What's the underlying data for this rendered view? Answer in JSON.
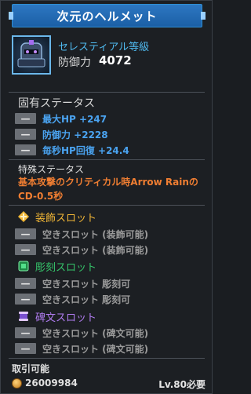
{
  "header": {
    "title": "次元のヘルメット"
  },
  "item": {
    "name": "セレスティアル等級",
    "defense_label": "防御力",
    "defense_value": "4072"
  },
  "inherent": {
    "title": "固有ステータス",
    "stats": [
      {
        "text": "最大HP +247"
      },
      {
        "text": "防御力 +2228"
      },
      {
        "text": "毎秒HP回復 +24.4"
      }
    ]
  },
  "special": {
    "title": "特殊ステータス",
    "text": "基本攻撃のクリティカル時Arrow Rainの CD-0.5秒"
  },
  "accessory": {
    "title": "装飾スロット",
    "slots": [
      "空きスロット (装飾可能)",
      "空きスロット (装飾可能)"
    ]
  },
  "engrave": {
    "title": "彫刻スロット",
    "slots": [
      "空きスロット 彫刻可",
      "空きスロット 彫刻可"
    ]
  },
  "rune": {
    "title": "碑文スロット",
    "slots": [
      "空きスロット (碑文可能)",
      "空きスロット (碑文可能)"
    ]
  },
  "footer": {
    "tradable": "取引可能",
    "price": "26009984",
    "level_req": "Lv.80必要"
  },
  "ui": {
    "minus": "—"
  },
  "colors": {
    "title_blue": "#1b5fa6",
    "name_cyan": "#4fb9ee",
    "stat_blue": "#4aa3f0",
    "special_orange": "#f07e32",
    "accessory_gold": "#f2b737",
    "engrave_green": "#35c46a",
    "rune_purple": "#b07cf0"
  }
}
